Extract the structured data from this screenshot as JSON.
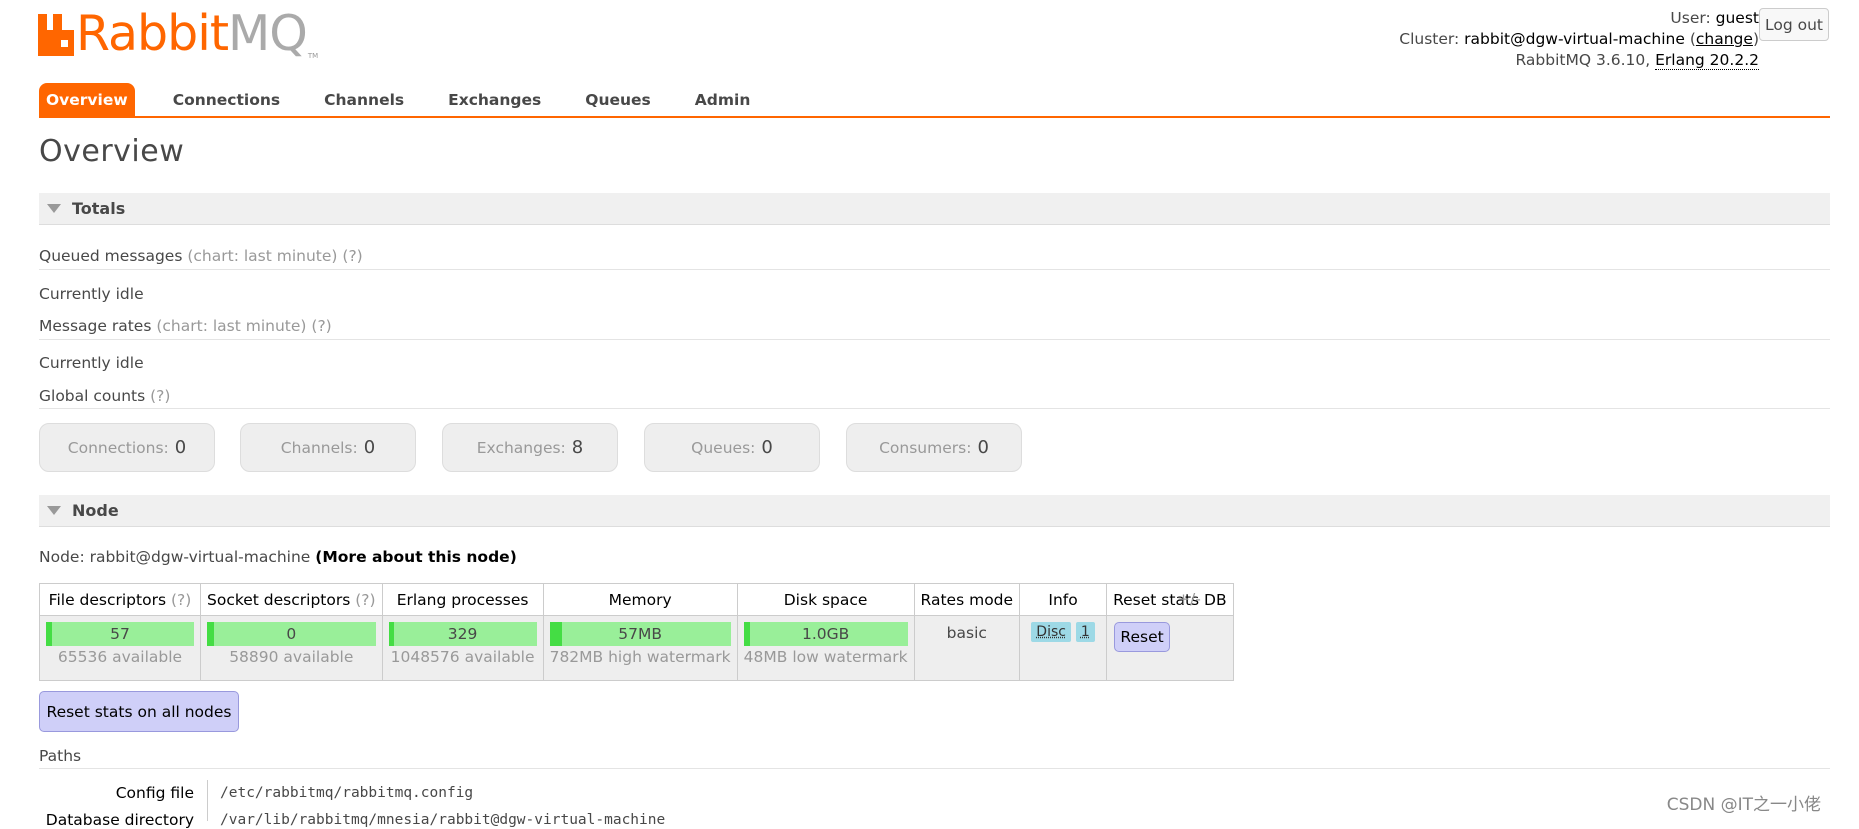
{
  "app": {
    "logo_text_rabbit": "Rabbit",
    "logo_text_mq": "MQ",
    "logo_tm": "TM",
    "brand_color": "#ff6600"
  },
  "login": {
    "user_label": "User:",
    "user": "guest",
    "cluster_label": "Cluster:",
    "cluster": "rabbit@dgw-virtual-machine",
    "change": "change",
    "version": "RabbitMQ 3.6.10,",
    "erlang": "Erlang 20.2.2",
    "logout": "Log out"
  },
  "tabs": [
    {
      "label": "Overview",
      "active": true
    },
    {
      "label": "Connections"
    },
    {
      "label": "Channels"
    },
    {
      "label": "Exchanges"
    },
    {
      "label": "Queues"
    },
    {
      "label": "Admin"
    }
  ],
  "page_title": "Overview",
  "totals": {
    "title": "Totals",
    "queued_label": "Queued messages",
    "queued_chart": "(chart: last minute)",
    "queued_help": "(?)",
    "queued_status": "Currently idle",
    "rates_label": "Message rates",
    "rates_chart": "(chart: last minute)",
    "rates_help": "(?)",
    "rates_status": "Currently idle",
    "global_label": "Global counts",
    "global_help": "(?)",
    "counts": [
      {
        "label": "Connections:",
        "value": "0"
      },
      {
        "label": "Channels:",
        "value": "0"
      },
      {
        "label": "Exchanges:",
        "value": "8"
      },
      {
        "label": "Queues:",
        "value": "0"
      },
      {
        "label": "Consumers:",
        "value": "0"
      }
    ]
  },
  "node": {
    "title": "Node",
    "node_label": "Node: rabbit@dgw-virtual-machine",
    "more": "(More about this node)",
    "headers": {
      "fd": "File descriptors",
      "sd": "Socket descriptors",
      "help": "(?)",
      "erl": "Erlang processes",
      "mem": "Memory",
      "disk": "Disk space",
      "rates": "Rates mode",
      "info": "Info",
      "reset": "Reset stats DB"
    },
    "fd_value": "57",
    "fd_sub": "65536 available",
    "fd_fraction": 0.0009,
    "sd_value": "0",
    "sd_sub": "58890 available",
    "sd_fraction": 0.0,
    "erl_value": "329",
    "erl_sub": "1048576 available",
    "erl_fraction": 0.0003,
    "mem_value": "57MB",
    "mem_sub": "782MB high watermark",
    "mem_fraction": 0.07,
    "disk_value": "1.0GB",
    "disk_sub": "48MB low watermark",
    "disk_fraction": 0.04,
    "rates_value": "basic",
    "info_disc": "Disc",
    "info_num": "1",
    "reset_button": "Reset",
    "plusminus": "+/-"
  },
  "reset_all": "Reset stats on all nodes",
  "paths": {
    "title": "Paths",
    "config_label": "Config file",
    "config_value": "/etc/rabbitmq/rabbitmq.config",
    "db_label": "Database directory",
    "db_value": "/var/lib/rabbitmq/mnesia/rabbit@dgw-virtual-machine"
  },
  "watermark": "CSDN @IT之一小佬"
}
